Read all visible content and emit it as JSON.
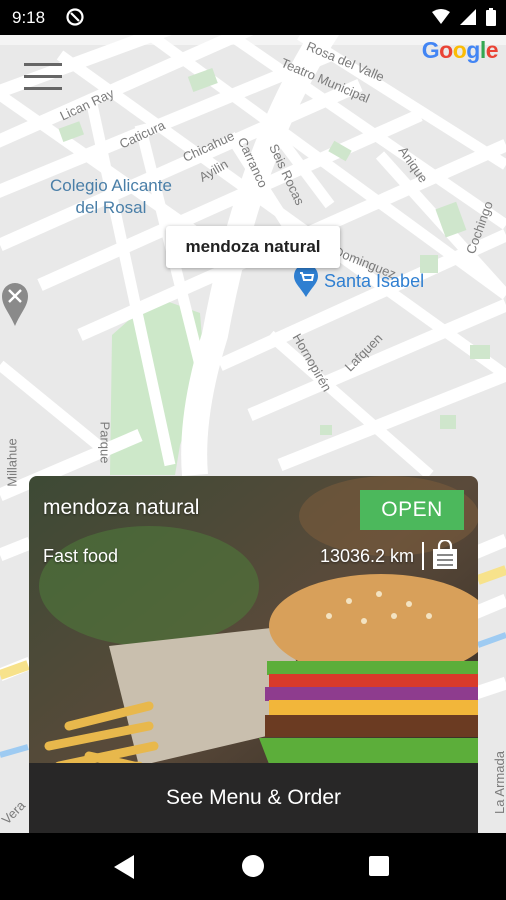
{
  "status_bar": {
    "time": "9:18"
  },
  "map": {
    "google_logo": {
      "letters": [
        "G",
        "o",
        "o",
        "g",
        "l",
        "e"
      ],
      "colors": [
        "#4285F4",
        "#EA4335",
        "#FBBC05",
        "#4285F4",
        "#34A853",
        "#EA4335"
      ]
    },
    "streets": {
      "rosa_del_valle": "Rosa del Valle",
      "teatro_municipal": "Teatro Municipal",
      "lican_ray": "Lican Ray",
      "caticura": "Caticura",
      "chicahue": "Chicahue",
      "carranco": "Carranco",
      "ayilin": "Ayilin",
      "seis_rocas": "Seis Rocas",
      "anique": "Anique",
      "cochingo": "Cochingo",
      "hornopiren": "Hornopirén",
      "lafquen": "Lafquen",
      "dominguez": "Dominguez",
      "parque": "Parque",
      "millahue": "Millahue",
      "la_armada": "La Armada",
      "vera": "Vera"
    },
    "poi_school": "Colegio Alicante\ndel Rosal",
    "poi_store": "Santa Isabel",
    "pin_tooltip": "mendoza natural"
  },
  "restaurant_card": {
    "name": "mendoza natural",
    "status": "OPEN",
    "category": "Fast food",
    "distance": "13036.2 km",
    "cta": "See Menu & Order",
    "status_color": "#4cb85c"
  }
}
